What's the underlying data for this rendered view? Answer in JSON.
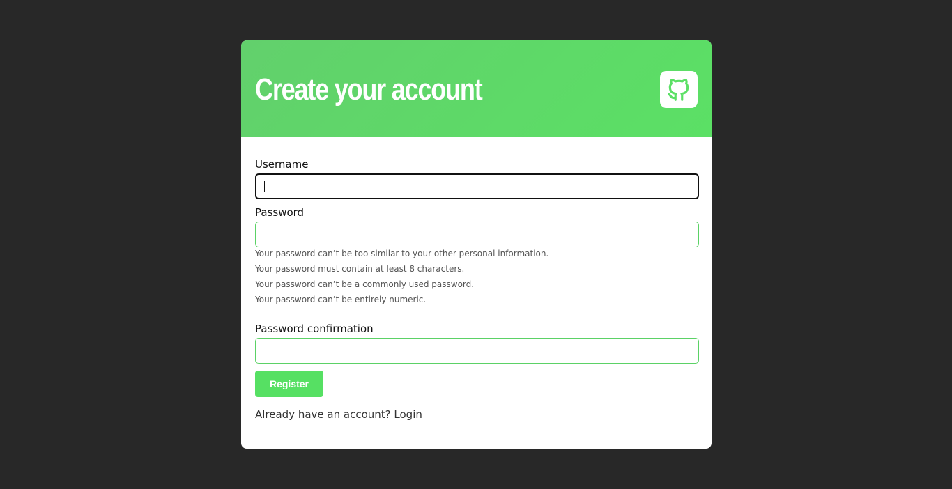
{
  "header": {
    "title": "Create your account",
    "logo_icon": "github-icon"
  },
  "form": {
    "username_label": "Username",
    "username_value": "",
    "password_label": "Password",
    "password_value": "",
    "password_help": [
      "Your password can’t be too similar to your other personal information.",
      "Your password must contain at least 8 characters.",
      "Your password can’t be a commonly used password.",
      "Your password can’t be entirely numeric."
    ],
    "password_confirmation_label": "Password confirmation",
    "password_confirmation_value": "",
    "register_label": "Register"
  },
  "footer": {
    "prompt": "Already have an account?",
    "login_label": "Login"
  },
  "colors": {
    "background": "#282828",
    "accent": "#5be065",
    "input_border": "#5bd266",
    "focus_border": "#111111"
  }
}
